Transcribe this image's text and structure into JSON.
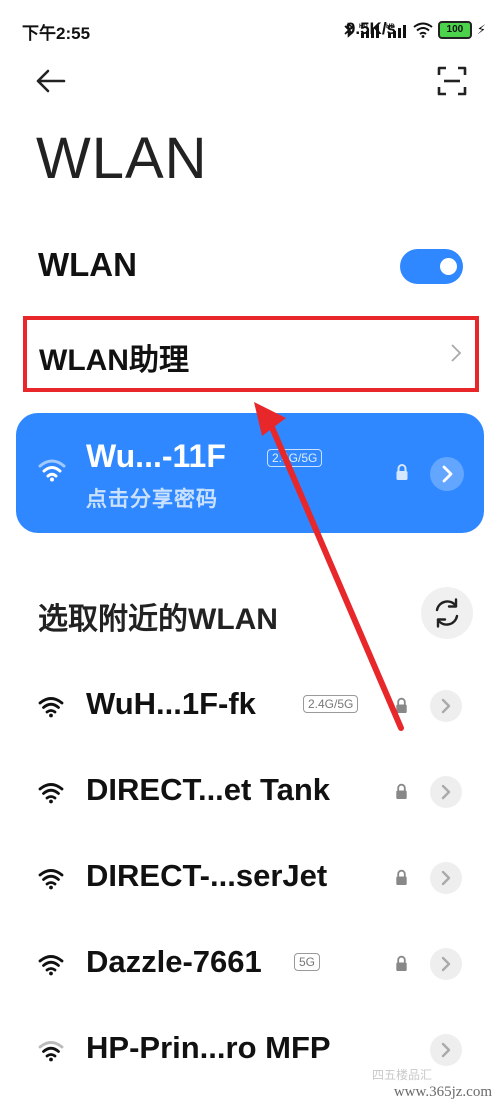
{
  "status_bar": {
    "time": "下午2:55",
    "net_speed": "9.5K/s",
    "signal_tags": [
      "HD",
      "HD"
    ],
    "battery": "100"
  },
  "header": {
    "back_icon": "arrow-left-icon",
    "scan_icon": "scan-qr-icon"
  },
  "page_title": "WLAN",
  "wlan_toggle": {
    "label": "WLAN",
    "on": true,
    "accent": "#2f88ff"
  },
  "assistant": {
    "label": "WLAN助理"
  },
  "connected": {
    "name": "Wu...-11F",
    "band": "2.4G/5G",
    "subtitle": "点击分享密码"
  },
  "nearby": {
    "title": "选取附近的WLAN",
    "networks": [
      {
        "name": "WuH...1F-fk",
        "band": "2.4G/5G",
        "locked": true
      },
      {
        "name": "DIRECT...et Tank",
        "band": "",
        "locked": true
      },
      {
        "name": "DIRECT-...serJet",
        "band": "",
        "locked": true
      },
      {
        "name": "Dazzle-7661",
        "band": "5G",
        "locked": true
      },
      {
        "name": "HP-Prin...ro MFP",
        "band": "",
        "locked": false
      }
    ]
  },
  "annotation": {
    "color": "#e8272a"
  },
  "watermark": {
    "site": "www.365jz.com",
    "faint": "四五楼品汇"
  }
}
